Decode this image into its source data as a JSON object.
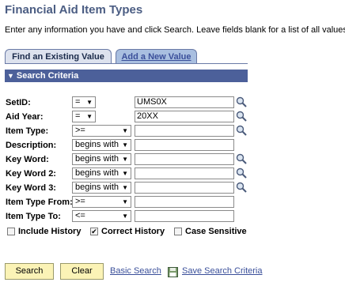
{
  "page": {
    "title": "Financial Aid Item Types",
    "instructions": "Enter any information you have and click Search. Leave fields blank for a list of all values."
  },
  "tabs": [
    {
      "label": "Find an Existing Value",
      "active": true
    },
    {
      "label": "Add a New Value",
      "active": false
    }
  ],
  "section": {
    "label": "Search Criteria"
  },
  "fields": [
    {
      "label": "SetID:",
      "operator": "=",
      "value": "UMS0X",
      "lookup": true
    },
    {
      "label": "Aid Year:",
      "operator": "=",
      "value": "20XX",
      "lookup": true
    },
    {
      "label": "Item Type:",
      "operator": ">=",
      "value": "",
      "lookup": true
    },
    {
      "label": "Description:",
      "operator": "begins with",
      "value": "",
      "lookup": false
    },
    {
      "label": "Key Word:",
      "operator": "begins with",
      "value": "",
      "lookup": true
    },
    {
      "label": "Key Word 2:",
      "operator": "begins with",
      "value": "",
      "lookup": true
    },
    {
      "label": "Key Word 3:",
      "operator": "begins with",
      "value": "",
      "lookup": true
    },
    {
      "label": "Item Type From:",
      "operator": ">=",
      "value": "",
      "lookup": false
    },
    {
      "label": "Item Type To:",
      "operator": "<=",
      "value": "",
      "lookup": false
    }
  ],
  "checkboxes": [
    {
      "label": "Include History",
      "checked": false
    },
    {
      "label": "Correct History",
      "checked": true
    },
    {
      "label": "Case Sensitive",
      "checked": false
    }
  ],
  "buttons": {
    "search": "Search",
    "clear": "Clear"
  },
  "links": {
    "basic_search": "Basic Search",
    "save_search": "Save Search Criteria"
  },
  "colors": {
    "title": "#4b5d83",
    "section_bar": "#4c609a",
    "button_bg": "#fbf3b6",
    "link": "#3a4f9a"
  }
}
